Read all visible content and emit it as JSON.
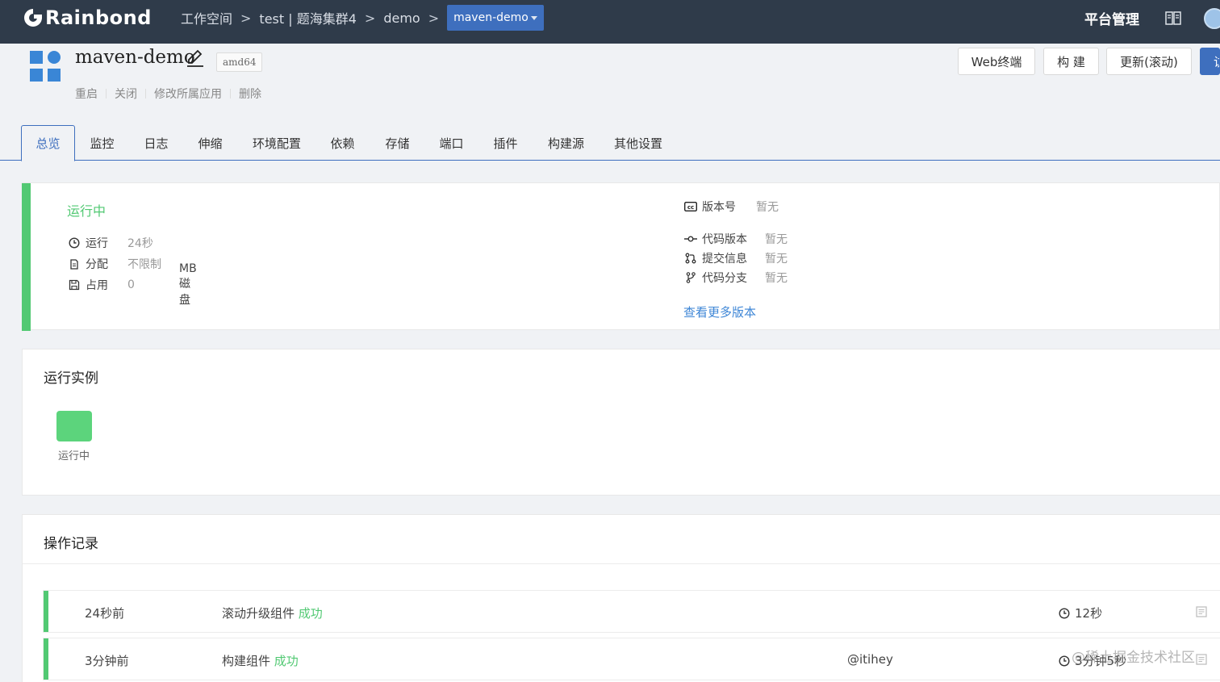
{
  "topbar": {
    "logo_text": "Rainbond",
    "breadcrumb": [
      "工作空间",
      "test | 题海集群4",
      "demo"
    ],
    "breadcrumb_sep": ">",
    "current_app": "maven-demo",
    "platform_label": "平台管理"
  },
  "app": {
    "name": "maven-demo",
    "arch": "amd64",
    "actions": [
      "重启",
      "关闭",
      "修改所属应用",
      "删除"
    ],
    "buttons": {
      "terminal": "Web终端",
      "build": "构 建",
      "update": "更新(滚动)",
      "primary_partial": "访"
    }
  },
  "tabs": [
    "总览",
    "监控",
    "日志",
    "伸缩",
    "环境配置",
    "依赖",
    "存储",
    "端口",
    "插件",
    "构建源",
    "其他设置"
  ],
  "status": {
    "title": "运行中",
    "run_label": "运行",
    "run_value": "24秒",
    "alloc_label": "分配",
    "alloc_value": "不限制",
    "used_label": "占用",
    "used_value": "0",
    "used_unit": "MB 磁盘",
    "version_label": "版本号",
    "version_value": "暂无",
    "code_version_label": "代码版本",
    "code_version_value": "暂无",
    "commit_label": "提交信息",
    "commit_value": "暂无",
    "branch_label": "代码分支",
    "branch_value": "暂无",
    "more_link": "查看更多版本"
  },
  "instances": {
    "title": "运行实例",
    "items": [
      {
        "status": "运行中",
        "color": "#5cd47c"
      }
    ]
  },
  "records": {
    "title": "操作记录",
    "items": [
      {
        "time": "24秒前",
        "action": "滚动升级组件",
        "result": "成功",
        "user": "",
        "duration": "12秒"
      },
      {
        "time": "3分钟前",
        "action": "构建组件",
        "result": "成功",
        "user": "@itihey",
        "duration": "3分钟5秒"
      }
    ]
  },
  "watermark": "@稀土掘金技术社区",
  "colors": {
    "topbar": "#2f3b4a",
    "primary": "#3e6fbe",
    "success": "#52c973",
    "link": "#3e86d6"
  }
}
